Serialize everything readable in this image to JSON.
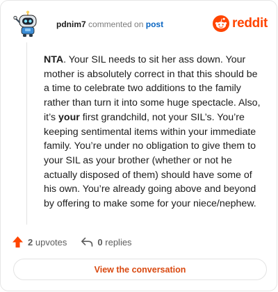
{
  "header": {
    "username": "pdnim7",
    "verb": "commented on",
    "post_link": "post",
    "brand_wordmark": "reddit"
  },
  "comment": {
    "lead": "NTA",
    "segment_1": ". Your SIL needs to sit her ass down. Your mother is absolutely correct in that this should be a time to celebrate two additions to the family rather than turn it into some huge spectacle. Also, it’s ",
    "emphasis": "your",
    "segment_2": " first grandchild, not your SIL’s. You’re keeping sentimental items within your immediate family. You’re under no obligation to give them to your SIL as your brother (whether or not he actually disposed of them) should have some of his own. You’re already going above and beyond by offering to make some for your niece/nephew."
  },
  "actions": {
    "upvotes_count": "2",
    "upvotes_label": "upvotes",
    "replies_count": "0",
    "replies_label": "replies"
  },
  "cta": {
    "label": "View the conversation"
  },
  "colors": {
    "brand_orange": "#ff4500",
    "link_blue": "#0a66c2",
    "cta_text": "#d9480f"
  },
  "icons": {
    "upvote": "upvote-arrow-icon",
    "reply": "reply-arrow-icon",
    "brand": "reddit-snoo-logo-icon",
    "avatar": "robot-avatar-icon"
  }
}
